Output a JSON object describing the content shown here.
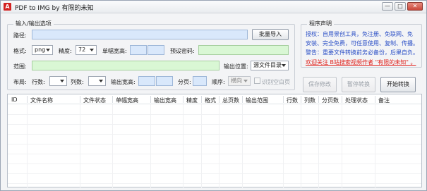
{
  "window": {
    "title": "PDF to IMG  by 有限的未知",
    "icon": "pdf-icon",
    "icon_letter": "A",
    "controls": [
      "—",
      "□",
      "✕"
    ]
  },
  "io_group": {
    "legend": "输入/输出选项",
    "path_label": "路径:",
    "batch_import": "批量导入",
    "format_label": "格式:",
    "format_value": "png",
    "precision_label": "精度:",
    "precision_value": "72",
    "page_size_label": "单幅宽高:",
    "password_label": "预设密码:",
    "range_label": "范围:",
    "output_location_label": "输出位置:",
    "output_location_value": "源文件目录",
    "layout_label": "布局:",
    "rows_label": "行数:",
    "cols_label": "列数:",
    "output_size_label": "输出宽高:",
    "split_label": "分页:",
    "order_label": "顺序:",
    "order_value": "横向",
    "detect_blank_label": "识别空白页"
  },
  "info_group": {
    "legend": "程序声明",
    "lines": [
      "授权：自用景创工具，免注册、免联网、免",
      "安装、完全免费，可任意使用、复制、传播。",
      "警告：重要文件转换前务必备份，后果自负。"
    ],
    "link": "欢迎关注 B站搜索视频作者 \"有限的未知\" 。"
  },
  "actions": {
    "save": "保存修改",
    "pause": "暂停转换",
    "start": "开始转换"
  },
  "table": {
    "columns": [
      "ID",
      "文件名称",
      "文件状态",
      "单幅宽高",
      "输出宽高",
      "精度",
      "格式",
      "总页数",
      "输出范围",
      "行数",
      "列数",
      "分页数",
      "处理状态",
      "备注"
    ],
    "rows": []
  },
  "colors": {
    "input_blue": "#d9e8fb",
    "input_green": "#d9f7d4",
    "note_blue": "#2b4fc6",
    "link_red": "#e0201a"
  }
}
